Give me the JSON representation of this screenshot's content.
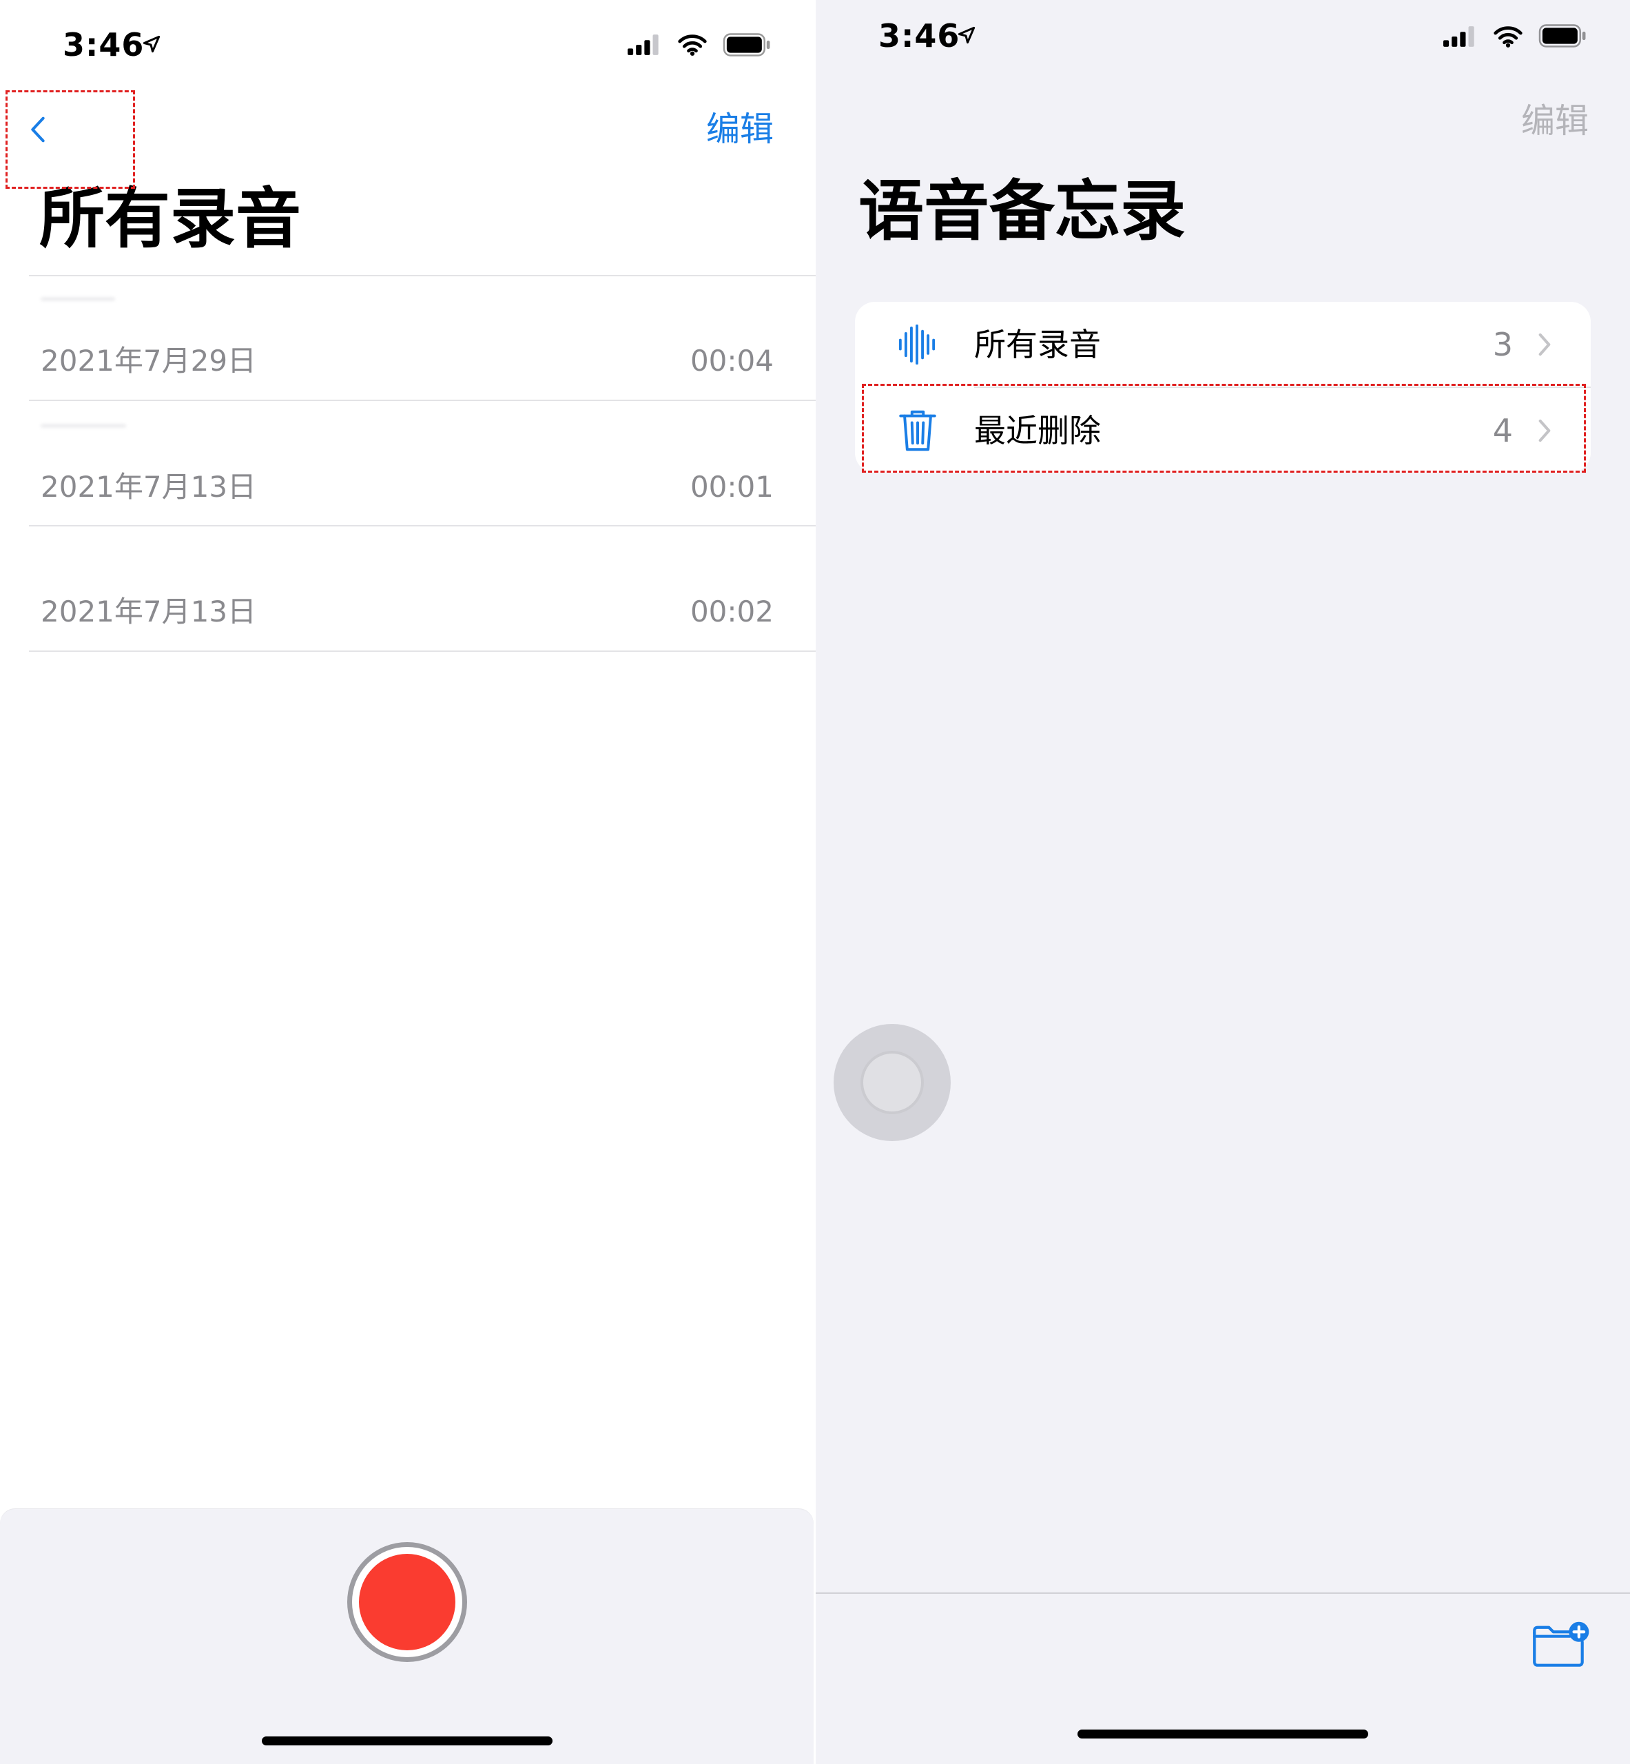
{
  "left": {
    "status_bar": {
      "time": "3:46"
    },
    "nav": {
      "edit_label": "编辑"
    },
    "title": "所有录音",
    "recordings": [
      {
        "date": "2021年7月29日",
        "duration": "00:04"
      },
      {
        "date": "2021年7月13日",
        "duration": "00:01"
      },
      {
        "date": "2021年7月13日",
        "duration": "00:02"
      }
    ]
  },
  "right": {
    "status_bar": {
      "time": "3:46"
    },
    "nav": {
      "edit_label": "编辑"
    },
    "title": "语音备忘录",
    "folders": [
      {
        "icon": "waveform-icon",
        "label": "所有录音",
        "count": "3"
      },
      {
        "icon": "trash-icon",
        "label": "最近删除",
        "count": "4"
      }
    ],
    "toolbar": {
      "icon": "new-folder-icon"
    }
  },
  "colors": {
    "accent": "#1a7ee6",
    "record": "#fa3c30",
    "secondary_text": "#8a8a8e",
    "grouped_background": "#f2f2f7",
    "highlight": "#e02020"
  }
}
